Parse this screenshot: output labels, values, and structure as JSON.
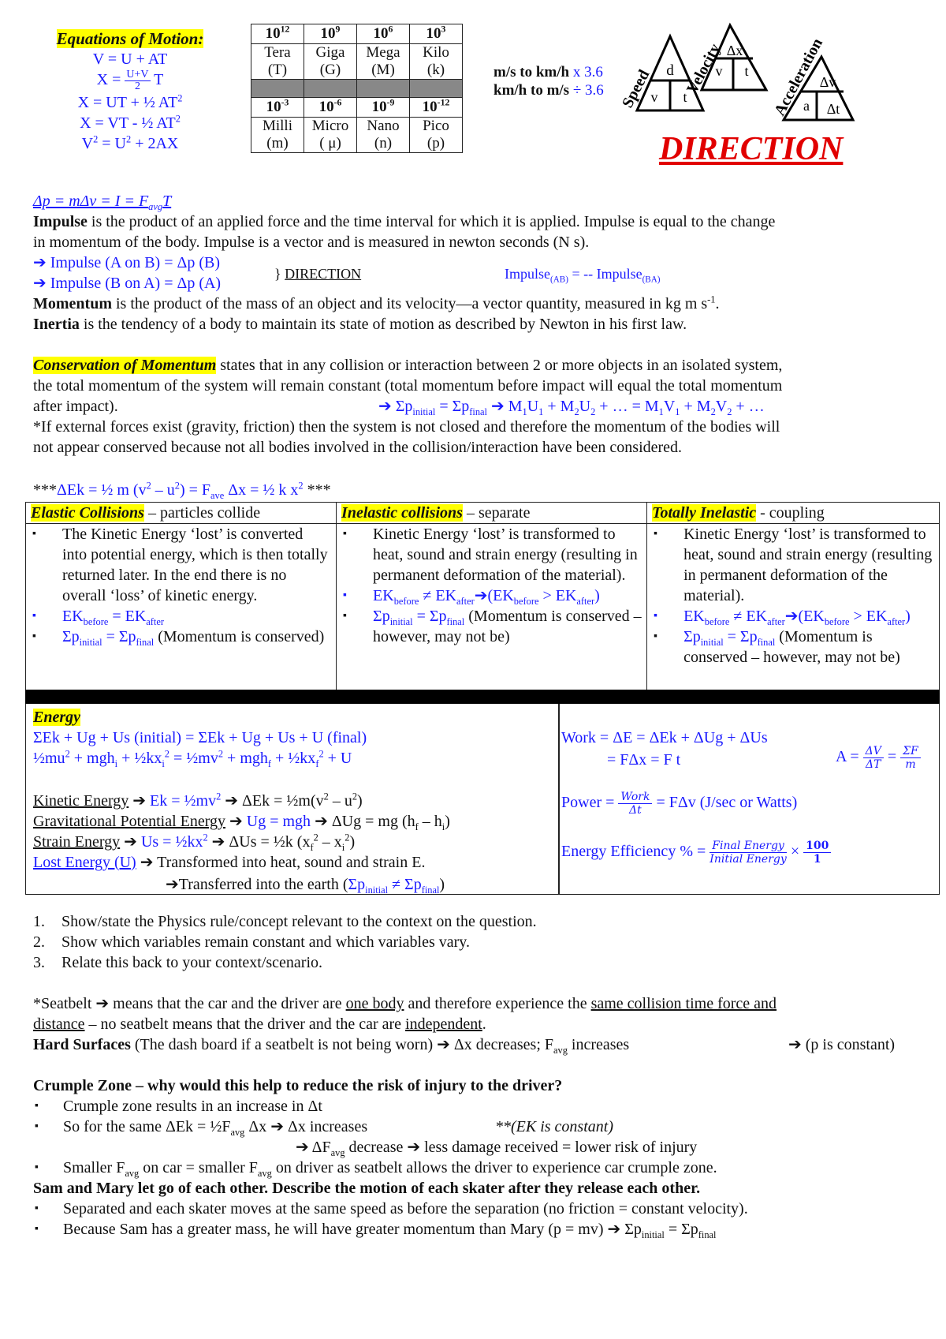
{
  "equations_of_motion": {
    "title": "Equations of Motion:",
    "eq1": "V = U + AT",
    "eq2_lhs": "X = ",
    "eq2_num": "U+V",
    "eq2_den": "2",
    "eq2_rhs": " T",
    "eq3": "X = UT + ½ AT",
    "eq4": "X = VT - ½ AT",
    "eq5_a": "V",
    "eq5_b": " = U",
    "eq5_c": " + 2AX",
    "sq": "2"
  },
  "prefix_table": {
    "large": [
      {
        "base": "10",
        "exp": "12",
        "name": "Tera",
        "symbol": "(T)"
      },
      {
        "base": "10",
        "exp": "9",
        "name": "Giga",
        "symbol": "(G)"
      },
      {
        "base": "10",
        "exp": "6",
        "name": "Mega",
        "symbol": "(M)"
      },
      {
        "base": "10",
        "exp": "3",
        "name": "Kilo",
        "symbol": "(k)"
      }
    ],
    "small": [
      {
        "base": "10",
        "exp": "-3",
        "name": "Milli",
        "symbol": "(m)"
      },
      {
        "base": "10",
        "exp": "-6",
        "name": "Micro",
        "symbol": "( μ)"
      },
      {
        "base": "10",
        "exp": "-9",
        "name": "Nano",
        "symbol": "(n)"
      },
      {
        "base": "10",
        "exp": "-12",
        "name": "Pico",
        "symbol": "(p)"
      }
    ]
  },
  "conversions": {
    "line1_label": "m/s to km/h",
    "line1_op": " x 3.6",
    "line2_label": "km/h to m/s",
    "line2_op": " ÷ 3.6"
  },
  "triangles": {
    "speed": {
      "label": "Speed",
      "top": "d",
      "left": "v",
      "right": "t"
    },
    "velocity": {
      "label": "Velocity",
      "top": "Δx",
      "left": "v",
      "right": "t"
    },
    "acceleration": {
      "label": "Acceleration",
      "top": "Δv",
      "left": "a",
      "right": "Δt"
    }
  },
  "direction_banner": "DIRECTION",
  "impulse": {
    "formula_a": "Δp = mΔv = I = F",
    "formula_sub": "avg",
    "formula_b": "T",
    "def_term": "Impulse",
    "def_line1": " is the product of an applied force and the time interval for which it is applied. Impulse is equal to the change",
    "def_line2": "in momentum of the body. Impulse is a vector and is measured in newton seconds (N s).",
    "arrow1": "➔ Impulse (A on B) = Δp (B)",
    "arrow2": "➔ Impulse (B on A) = Δp (A)",
    "brace_label": "} ",
    "brace_dir": "DIRECTION",
    "rel_a": "Impulse",
    "rel_sub1": "(AB)",
    "rel_b": " = -- Impulse",
    "rel_sub2": "(BA)",
    "momentum_term": "Momentum",
    "momentum_def": " is the product of the mass of an object and its velocity—a vector quantity, measured in kg m s",
    "momentum_sup": "-1",
    "momentum_end": ".",
    "inertia_term": "Inertia",
    "inertia_def": " is the tendency of a body to maintain its state of motion as described by Newton in his first law."
  },
  "conservation": {
    "term": "Conservation of Momentum",
    "line1": " states that in any collision or interaction between 2 or more objects in an isolated system,",
    "line2": "the total momentum of the system will remain constant (total momentum before impact will equal the total momentum",
    "line3": "after impact).",
    "formula": "➔ Σp",
    "f_sub1": "initial",
    "f_mid": " = Σp",
    "f_sub2": "final",
    "f_rest_a": " ➔ M",
    "f_rest_b": "U",
    "f_rest_c": " + M",
    "f_rest_d": "U",
    "f_rest_e": " + … = M",
    "f_rest_f": "V",
    "f_rest_g": " + M",
    "f_rest_h": "V",
    "f_rest_i": " + …",
    "one": "1",
    "two": "2",
    "note1": "*If external forces exist (gravity, friction) then the system is not closed and therefore the momentum of the bodies will",
    "note2": "not appear conserved because not all bodies involved in the collision/interaction have been considered."
  },
  "energy_headline": {
    "stars": "***",
    "a": "ΔEk = ½ m (v",
    "b": " – u",
    "c": ") = F",
    "sub": "ave",
    "d": " Δx = ½ k x",
    "sq": "2",
    "stars_end": " ***"
  },
  "collisions": {
    "elastic": {
      "term": "Elastic Collisions",
      "sub": " – particles collide",
      "bullet1": "The Kinetic Energy ‘lost’ is converted into potential energy, which is then totally returned later. In the end there is no overall ‘loss’ of kinetic energy.",
      "bullet2_a": "EK",
      "bullet2_s1": "before",
      "bullet2_b": " = EK",
      "bullet2_s2": "after",
      "bullet3_a": "Σp",
      "bullet3_s1": "initial",
      "bullet3_b": " = Σp",
      "bullet3_s2": "final",
      "bullet3_c": " (Momentum is conserved)"
    },
    "inelastic": {
      "term": "Inelastic collisions",
      "sub": " – separate",
      "bullet1": "Kinetic Energy ‘lost’ is transformed to heat, sound and strain energy (resulting in permanent deformation of the material).",
      "bullet2_a": "EK",
      "bullet2_s1": "before",
      "bullet2_b": " ≠ EK",
      "bullet2_s2": "after",
      "bullet2_c": "➔(EK",
      "bullet2_d": " > EK",
      "bullet2_e": ")",
      "bullet3_a": "Σp",
      "bullet3_s1": "initial",
      "bullet3_b": " = Σp",
      "bullet3_s2": "final",
      "bullet3_c": " (Momentum is conserved – however, may not be)"
    },
    "totally": {
      "term": "Totally Inelastic",
      "sub": " - coupling",
      "bullet1": "Kinetic Energy ‘lost’ is transformed to heat, sound and strain energy (resulting in permanent deformation of the material).",
      "bullet2_a": "EK",
      "bullet2_s1": "before",
      "bullet2_b": " ≠ EK",
      "bullet2_s2": "after",
      "bullet2_c": "➔(EK",
      "bullet2_d": " > EK",
      "bullet2_e": ")",
      "bullet3_a": "Σp",
      "bullet3_s1": "initial",
      "bullet3_b": " = Σp",
      "bullet3_s2": "final",
      "bullet3_c": " (Momentum is conserved – however, may not be)"
    }
  },
  "energy": {
    "title": "Energy",
    "cons1": "ΣEk + Ug + Us (initial) = ΣEk + Ug + Us + U (final)",
    "cons2_a": "½mu",
    "cons2_b": " + mgh",
    "cons2_c": " + ½kx",
    "cons2_d": " = ½mv",
    "cons2_e": " + mgh",
    "cons2_f": " + ½kx",
    "cons2_g": " + U",
    "sub_i": "i",
    "sub_f": "f",
    "sq": "2",
    "ke_label": "Kinetic Energy",
    "ke_a": " ➔ ",
    "ke_b": "Ek = ½mv",
    "ke_c": " ➔ ΔEk = ½m(v",
    "ke_d": " – u",
    "ke_e": ")",
    "gpe_label": "Gravitational Potential Energy",
    "gpe_a": " ➔ ",
    "gpe_b": "Ug = mgh",
    "gpe_c": " ➔ ΔUg = mg (h",
    "gpe_d": " – h",
    "gpe_e": ")",
    "se_label": "Strain Energy",
    "se_a": " ➔ ",
    "se_b": "Us = ½kx",
    "se_c": " ➔ ΔUs = ½k (x",
    "se_d": " – x",
    "se_e": ")",
    "lost_label": "Lost Energy (U)",
    "lost_a": " ➔ Transformed into heat, sound and strain E.",
    "lost_b": "➔Transferred into the earth (",
    "lost_c": "Σp",
    "lost_s1": "initial",
    "lost_d": " ≠ Σp",
    "lost_s2": "final",
    "lost_e": ")",
    "work1": "Work = ΔE = ΔEk + ΔUg + ΔUs",
    "work2": "= FΔx = F t",
    "accel_lhs": "A = ",
    "accel_num1": "ΔV",
    "accel_den1": "ΔT",
    "accel_eq": " = ",
    "accel_num2": "ΣF",
    "accel_den2": "m",
    "power_lhs": "Power = ",
    "power_num": "Work",
    "power_den": "Δt",
    "power_rhs": " = FΔv (J/sec or Watts)",
    "eff_lhs": "Energy Efficiency % = ",
    "eff_num": "Final Energy",
    "eff_den": "Initial Energy",
    "eff_times": " × ",
    "eff_num2": "100",
    "eff_den2": "1"
  },
  "steps": [
    "Show/state the Physics rule/concept relevant to the context on the question.",
    "Show which variables remain constant and which variables vary.",
    "Relate this back to your context/scenario."
  ],
  "seatbelt": {
    "a": "*Seatbelt ➔ means that the car and the driver are ",
    "u1": "one body",
    "b": " and therefore experience the ",
    "u2": "same collision time force and",
    "u3": "distance",
    "c": " – no seatbelt means that the driver and the car are ",
    "u4": "independent",
    "d": "."
  },
  "hard_surfaces": {
    "term": "Hard Surfaces",
    "a": " (The dash board if a seatbelt is not being worn) ➔ Δx decreases; F",
    "sub": "avg",
    "b": " increases",
    "c": "➔ (p is constant)"
  },
  "crumple": {
    "heading": "Crumple Zone – why would this help to reduce the risk of injury to the driver?",
    "b1": "Crumple zone results in an increase in Δt",
    "b2_a": "So for the same ΔEk = ½F",
    "b2_b": " Δx ➔ Δx increases",
    "b2_note": "**(EK is constant)",
    "b2_line2_a": "➔ ΔF",
    "b2_line2_b": " decrease   ➔ less damage received = lower risk of injury",
    "b3_a": "Smaller F",
    "b3_b": " on car = smaller F",
    "b3_c": " on driver as seatbelt allows the driver to experience car crumple zone.",
    "avg": "avg"
  },
  "skaters": {
    "heading": "Sam and Mary let go of each other. Describe the motion of each skater after they release each other.",
    "b1": "Separated and each skater moves at the same speed as before the separation (no friction = constant velocity).",
    "b2_a": "Because Sam has a greater mass, he will have greater momentum than Mary (p = mv) ➔ Σp",
    "b2_s1": "initial",
    "b2_b": " = Σp",
    "b2_s2": "final"
  }
}
